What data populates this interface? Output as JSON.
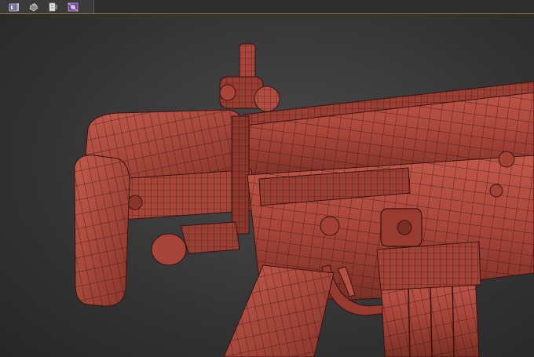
{
  "toolbar": {
    "buttons": [
      {
        "icon": "render-frame-icon"
      },
      {
        "icon": "teapot-icon"
      },
      {
        "icon": "render-setup-icon"
      },
      {
        "icon": "material-editor-icon"
      }
    ]
  },
  "viewport": {
    "mode": "wireframe-shaded",
    "object": "rifle-model",
    "colors": {
      "mesh_fill": "#a8453a",
      "mesh_dark": "#6e2a22",
      "mesh_light": "#c0584a",
      "wire": "#3a120e",
      "toolbar_accent": "#8a7a2a"
    }
  }
}
